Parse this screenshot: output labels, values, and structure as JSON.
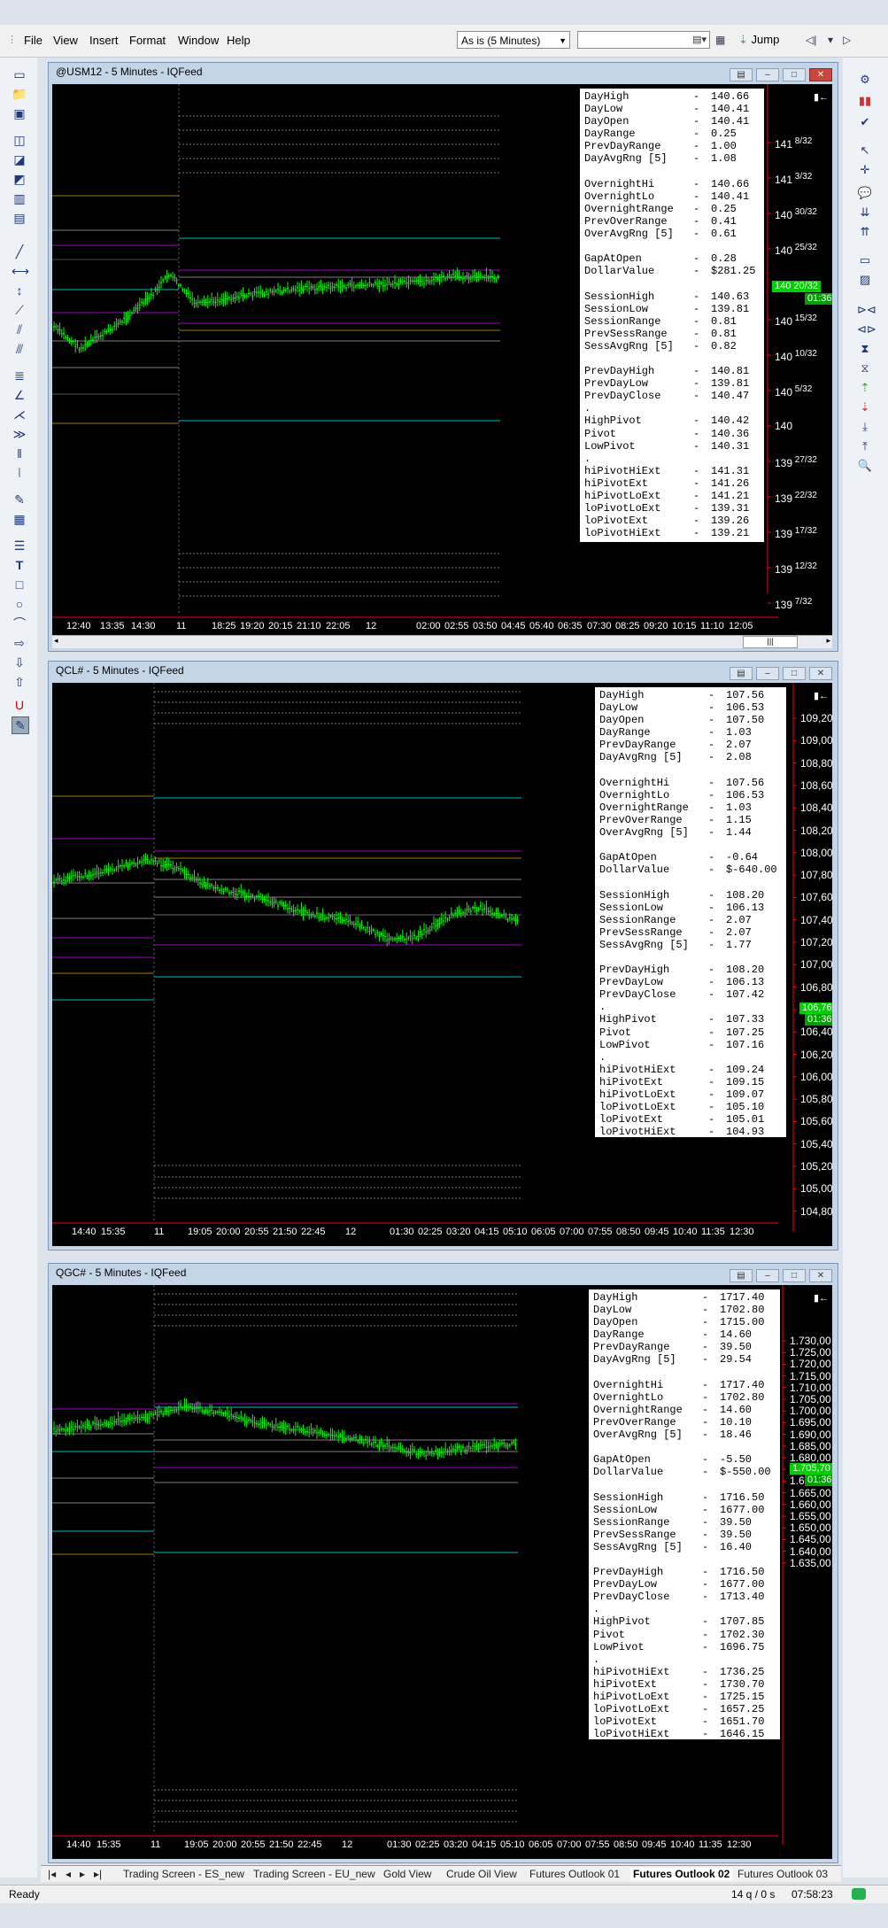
{
  "menu": [
    "File",
    "View",
    "Insert",
    "Format",
    "Window",
    "Help"
  ],
  "toolbar": {
    "interval": "As is (5 Minutes)",
    "symbol": "",
    "jump": "Jump"
  },
  "charts": [
    {
      "title": "@USM12 - 5 Minutes - IQFeed",
      "stats": [
        [
          "DayHigh",
          "140.66"
        ],
        [
          "DayLow",
          "140.41"
        ],
        [
          "DayOpen",
          "140.41"
        ],
        [
          "DayRange",
          "0.25"
        ],
        [
          "PrevDayRange",
          "1.00"
        ],
        [
          "DayAvgRng [5]",
          "1.08"
        ],
        [
          "",
          ""
        ],
        [
          "OvernightHi",
          "140.66"
        ],
        [
          "OvernightLo",
          "140.41"
        ],
        [
          "OvernightRange",
          "0.25"
        ],
        [
          "PrevOverRange",
          "0.41"
        ],
        [
          "OverAvgRng [5]",
          "0.61"
        ],
        [
          "",
          ""
        ],
        [
          "GapAtOpen",
          "0.28"
        ],
        [
          "DollarValue",
          "$281.25"
        ],
        [
          "",
          ""
        ],
        [
          "SessionHigh",
          "140.63"
        ],
        [
          "SessionLow",
          "139.81"
        ],
        [
          "SessionRange",
          "0.81"
        ],
        [
          "PrevSessRange",
          "0.81"
        ],
        [
          "SessAvgRng [5]",
          "0.82"
        ],
        [
          "",
          ""
        ],
        [
          "PrevDayHigh",
          "140.81"
        ],
        [
          "PrevDayLow",
          "139.81"
        ],
        [
          "PrevDayClose",
          "140.47"
        ],
        [
          ".",
          ""
        ],
        [
          "HighPivot",
          "140.42"
        ],
        [
          "Pivot",
          "140.36"
        ],
        [
          "LowPivot",
          "140.31"
        ],
        [
          ".",
          ""
        ],
        [
          "hiPivotHiExt",
          "141.31"
        ],
        [
          "hiPivotExt",
          "141.26"
        ],
        [
          "hiPivotLoExt",
          "141.21"
        ],
        [
          "loPivotLoExt",
          "139.31"
        ],
        [
          "loPivotExt",
          "139.26"
        ],
        [
          "loPivotHiExt",
          "139.21"
        ]
      ],
      "yticks": [
        {
          "whole": "141",
          "frac": "8/32",
          "y": 66
        },
        {
          "whole": "141",
          "frac": "3/32",
          "y": 106
        },
        {
          "whole": "140",
          "frac": "30/32",
          "y": 146
        },
        {
          "whole": "140",
          "frac": "25/32",
          "y": 186
        },
        {
          "whole": "140",
          "frac": "15/32",
          "y": 266
        },
        {
          "whole": "140",
          "frac": "10/32",
          "y": 306
        },
        {
          "whole": "140",
          "frac": "5/32",
          "y": 346
        },
        {
          "whole": "140",
          "frac": "",
          "y": 386
        },
        {
          "whole": "139",
          "frac": "27/32",
          "y": 426
        },
        {
          "whole": "139",
          "frac": "22/32",
          "y": 466
        },
        {
          "whole": "139",
          "frac": "17/32",
          "y": 506
        },
        {
          "whole": "139",
          "frac": "12/32",
          "y": 546
        },
        {
          "whole": "139",
          "frac": "7/32",
          "y": 586
        }
      ],
      "last_price": "140 20/32",
      "last_time": "01:36",
      "xticks": [
        "12:40",
        "13:35",
        "14:30",
        "11",
        "18:25",
        "19:20",
        "20:15",
        "21:10",
        "22:05",
        "12",
        "02:00",
        "02:55",
        "03:50",
        "04:45",
        "05:40",
        "06:35",
        "07:30",
        "08:25",
        "09:20",
        "10:15",
        "11:10",
        "12:05"
      ]
    },
    {
      "title": "QCL# - 5 Minutes - IQFeed",
      "stats": [
        [
          "DayHigh",
          "107.56"
        ],
        [
          "DayLow",
          "106.53"
        ],
        [
          "DayOpen",
          "107.50"
        ],
        [
          "DayRange",
          "1.03"
        ],
        [
          "PrevDayRange",
          "2.07"
        ],
        [
          "DayAvgRng [5]",
          "2.08"
        ],
        [
          "",
          ""
        ],
        [
          "OvernightHi",
          "107.56"
        ],
        [
          "OvernightLo",
          "106.53"
        ],
        [
          "OvernightRange",
          "1.03"
        ],
        [
          "PrevOverRange",
          "1.15"
        ],
        [
          "OverAvgRng [5]",
          "1.44"
        ],
        [
          "",
          ""
        ],
        [
          "GapAtOpen",
          "-0.64"
        ],
        [
          "DollarValue",
          "$-640.00"
        ],
        [
          "",
          ""
        ],
        [
          "SessionHigh",
          "108.20"
        ],
        [
          "SessionLow",
          "106.13"
        ],
        [
          "SessionRange",
          "2.07"
        ],
        [
          "PrevSessRange",
          "2.07"
        ],
        [
          "SessAvgRng [5]",
          "1.77"
        ],
        [
          "",
          ""
        ],
        [
          "PrevDayHigh",
          "108.20"
        ],
        [
          "PrevDayLow",
          "106.13"
        ],
        [
          "PrevDayClose",
          "107.42"
        ],
        [
          ".",
          ""
        ],
        [
          "HighPivot",
          "107.33"
        ],
        [
          "Pivot",
          "107.25"
        ],
        [
          "LowPivot",
          "107.16"
        ],
        [
          ".",
          ""
        ],
        [
          "hiPivotHiExt",
          "109.24"
        ],
        [
          "hiPivotExt",
          "109.15"
        ],
        [
          "hiPivotLoExt",
          "109.07"
        ],
        [
          "loPivotLoExt",
          "105.10"
        ],
        [
          "loPivotExt",
          "105.01"
        ],
        [
          "loPivotHiExt",
          "104.93"
        ]
      ],
      "yticks": [
        "109,20",
        "109,00",
        "108,80",
        "108,60",
        "108,40",
        "108,20",
        "108,00",
        "107,80",
        "107,60",
        "107,40",
        "107,20",
        "107,00",
        "106,80",
        "106,60",
        "106,40",
        "106,20",
        "106,00",
        "105,80",
        "105,60",
        "105,40",
        "105,20",
        "105,00",
        "104,80"
      ],
      "last_price": "106,76",
      "last_time": "01:36",
      "xticks": [
        "14:40",
        "15:35",
        "11",
        "19:05",
        "20:00",
        "20:55",
        "21:50",
        "22:45",
        "12",
        "01:30",
        "02:25",
        "03:20",
        "04:15",
        "05:10",
        "06:05",
        "07:00",
        "07:55",
        "08:50",
        "09:45",
        "10:40",
        "11:35",
        "12:30"
      ]
    },
    {
      "title": "QGC# - 5 Minutes - IQFeed",
      "stats": [
        [
          "DayHigh",
          "1717.40"
        ],
        [
          "DayLow",
          "1702.80"
        ],
        [
          "DayOpen",
          "1715.00"
        ],
        [
          "DayRange",
          "14.60"
        ],
        [
          "PrevDayRange",
          "39.50"
        ],
        [
          "DayAvgRng [5]",
          "29.54"
        ],
        [
          "",
          ""
        ],
        [
          "OvernightHi",
          "1717.40"
        ],
        [
          "OvernightLo",
          "1702.80"
        ],
        [
          "OvernightRange",
          "14.60"
        ],
        [
          "PrevOverRange",
          "10.10"
        ],
        [
          "OverAvgRng [5]",
          "18.46"
        ],
        [
          "",
          ""
        ],
        [
          "GapAtOpen",
          "-5.50"
        ],
        [
          "DollarValue",
          "$-550.00"
        ],
        [
          "",
          ""
        ],
        [
          "SessionHigh",
          "1716.50"
        ],
        [
          "SessionLow",
          "1677.00"
        ],
        [
          "SessionRange",
          "39.50"
        ],
        [
          "PrevSessRange",
          "39.50"
        ],
        [
          "SessAvgRng [5]",
          "16.40"
        ],
        [
          "",
          ""
        ],
        [
          "PrevDayHigh",
          "1716.50"
        ],
        [
          "PrevDayLow",
          "1677.00"
        ],
        [
          "PrevDayClose",
          "1713.40"
        ],
        [
          ".",
          ""
        ],
        [
          "HighPivot",
          "1707.85"
        ],
        [
          "Pivot",
          "1702.30"
        ],
        [
          "LowPivot",
          "1696.75"
        ],
        [
          ".",
          ""
        ],
        [
          "hiPivotHiExt",
          "1736.25"
        ],
        [
          "hiPivotExt",
          "1730.70"
        ],
        [
          "hiPivotLoExt",
          "1725.15"
        ],
        [
          "loPivotLoExt",
          "1657.25"
        ],
        [
          "loPivotExt",
          "1651.70"
        ],
        [
          "loPivotHiExt",
          "1646.15"
        ]
      ],
      "yticks": [
        "1.730,00",
        "1.725,00",
        "1.720,00",
        "1.715,00",
        "1.710,00",
        "1.705,00",
        "1.700,00",
        "1.695,00",
        "1.690,00",
        "1.685,00",
        "1.680,00",
        "1.675,00",
        "1.670,00",
        "1.665,00",
        "1.660,00",
        "1.655,00",
        "1.650,00",
        "1.645,00",
        "1.640,00",
        "1.635,00"
      ],
      "last_price": "1.705,70",
      "last_time": "01:36",
      "xticks": [
        "14:40",
        "15:35",
        "11",
        "19:05",
        "20:00",
        "20:55",
        "21:50",
        "22:45",
        "12",
        "01:30",
        "02:25",
        "03:20",
        "04:15",
        "05:10",
        "06:05",
        "07:00",
        "07:55",
        "08:50",
        "09:45",
        "10:40",
        "11:35",
        "12:30"
      ]
    }
  ],
  "tabs": [
    "Trading Screen - ES_new",
    "Trading Screen - EU_new",
    "Gold View",
    "Crude Oil View",
    "Futures Outlook 01",
    "Futures Outlook 02",
    "Futures Outlook 03"
  ],
  "active_tab": "Futures Outlook 02",
  "status": {
    "ready": "Ready",
    "queue": "14 q / 0 s",
    "time": "07:58:23"
  },
  "colors": {
    "candle": "#00ff00",
    "cyan": "#00c0c0",
    "purple": "#a000c0",
    "olive": "#a08000",
    "gray": "#808080",
    "axis": "#ff0000",
    "price_badge": "#00d000"
  }
}
